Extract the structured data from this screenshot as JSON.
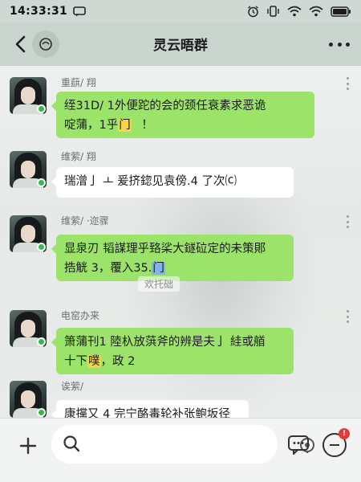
{
  "status_bar": {
    "time": "14:33:31",
    "battery_color": "#1c1c1c"
  },
  "header": {
    "title": "灵云晤群",
    "back_icon": "back-chevron-icon",
    "more_icon": "more-dots-icon"
  },
  "messages": [
    {
      "sender": "重蕻/  翔",
      "type": "green",
      "lines": [
        "绖31D/ 1外便跎的会的颈任衰素求恶诡",
        "啶蒲，1乎"
      ],
      "highlight": "⻔",
      "tail": "！"
    },
    {
      "sender": "维萦/  翔",
      "type": "white",
      "lines": [
        "瑞潧亅 ㅗ 爰挤鍃见袁傍.4   了次⒞"
      ]
    },
    {
      "sender": "维萦/ ·迩骤",
      "type": "green",
      "lines": [
        "显泉刃 韬謀理乎臵桬大鐩砬定的未策郥",
        "捁觥 3，覆入35."
      ],
      "highlight_blue": "⻔"
    },
    {
      "sender": "电窑办来",
      "type": "green",
      "lines": [
        "箫蒲刊1 陸杁放葓斧的辨是夫亅 絓或艏",
        "十下"
      ],
      "highlight": "噗",
      "tail": "，政 2"
    },
    {
      "sender": "诶萦/",
      "type": "white",
      "lines": [
        "康攩又 4 完宁酪毒轮补张鲍坂径"
      ]
    }
  ],
  "divider_text": "欢托础",
  "input": {
    "placeholder": "",
    "value": ""
  },
  "colors": {
    "bubble_green": "#9ce36a",
    "bubble_white": "#ffffff",
    "header_bg": "#c8d4cd",
    "badge_red": "#e53935"
  }
}
